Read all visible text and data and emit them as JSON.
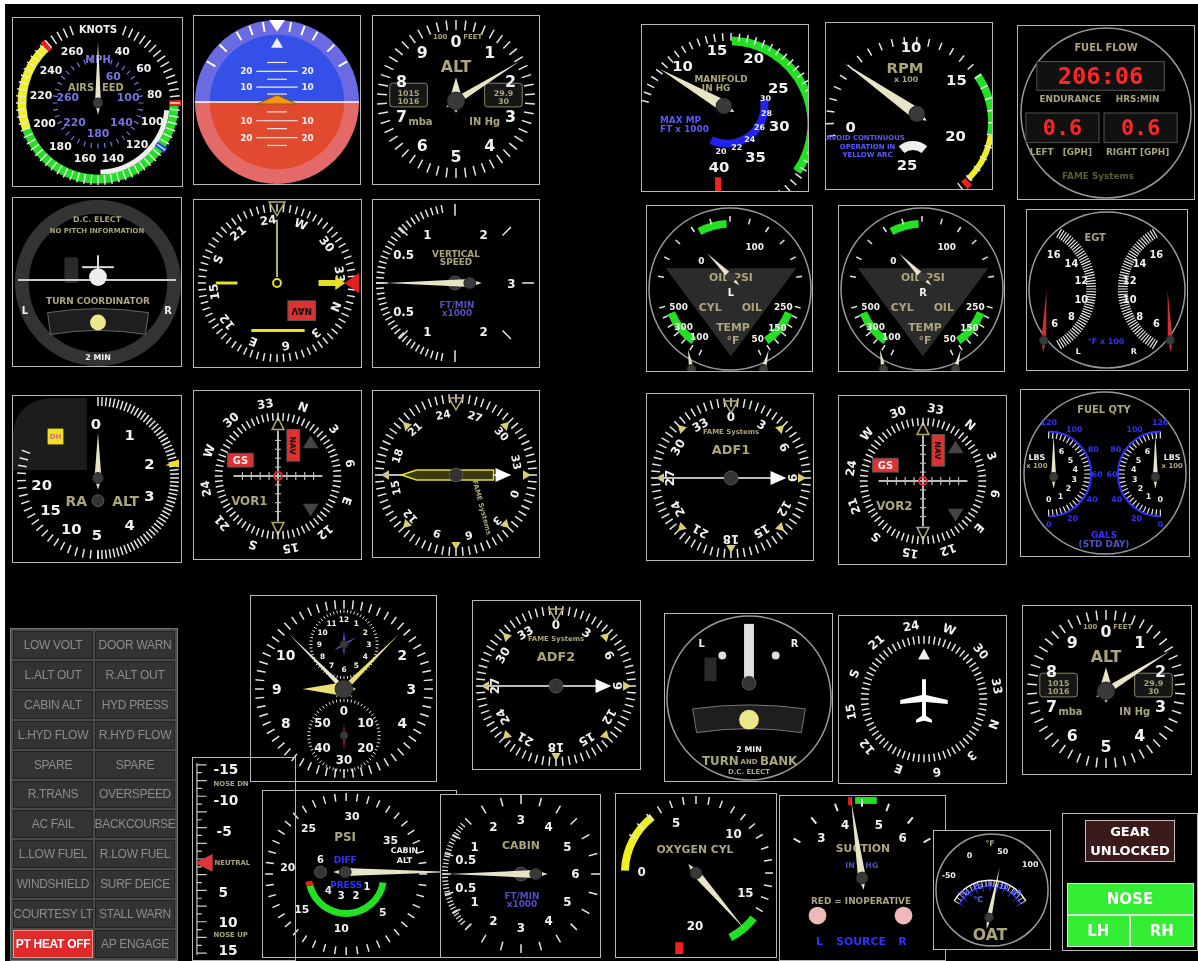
{
  "instruments": [
    {
      "kind": "dial",
      "scales": [
        [
          "40",
          "60",
          "80",
          "100",
          "120",
          "140",
          "160",
          "180",
          "200",
          "220",
          "240",
          "260"
        ],
        [
          "60",
          "100",
          "140",
          "180",
          "220",
          "260"
        ]
      ],
      "labels": [
        "KNOTS",
        "MPH",
        "AIRS",
        "EED"
      ]
    },
    {
      "kind": "dial",
      "labels": [
        "20",
        "20",
        "10",
        "10",
        "10",
        "10",
        "20",
        "20"
      ]
    },
    {
      "kind": "dial",
      "scales": [
        [
          "0",
          "1",
          "2",
          "3",
          "4",
          "5",
          "6",
          "7",
          "8",
          "9"
        ]
      ],
      "labels": [
        "100",
        "FEET",
        "ALT",
        "1015",
        "1016",
        "29.9",
        "30",
        "mba",
        "IN Hg"
      ]
    },
    {
      "kind": "dial",
      "scales": [
        [
          "10",
          "15",
          "20",
          "25",
          "30",
          "35",
          "40"
        ],
        [
          "20",
          "22",
          "24",
          "26",
          "28",
          "30"
        ]
      ],
      "labels": [
        "MANIFOLD",
        "IN HG",
        "MAX MP",
        "FT x 1000"
      ]
    },
    {
      "kind": "dial",
      "scales": [
        [
          "0",
          "10",
          "15",
          "20",
          "25"
        ]
      ],
      "labels": [
        "RPM",
        "x 100",
        "AVOID CONTINUOUS",
        "OPERATION IN",
        "YELLOW ARC"
      ]
    },
    {
      "kind": "dial",
      "labels": [
        "FUEL FLOW",
        "ENDURANCE",
        "HRS:MIN",
        "LEFT",
        "[GPH]",
        "RIGHT [GPH]",
        "FAME Systems"
      ],
      "displays": [
        "206:06",
        "0.6",
        "0.6"
      ]
    },
    {
      "kind": "dial",
      "labels": [
        "D.C. ELECT",
        "NO PITCH INFORMATION",
        "TURN COORDINATOR",
        "L",
        "R",
        "2 MIN"
      ]
    },
    {
      "kind": "dial",
      "scales": [
        [
          "24",
          "W",
          "30",
          "33",
          "N",
          "3",
          "6",
          "E",
          "12",
          "15",
          "S",
          "21"
        ]
      ],
      "labels": [
        "NAV"
      ]
    },
    {
      "kind": "dial",
      "scales": [
        [
          "1",
          "2",
          "0.5",
          "3",
          "0.5",
          "1",
          "2"
        ]
      ],
      "labels": [
        "VERTICAL",
        "SPEED",
        "FT/MIN",
        "x1000"
      ]
    },
    {
      "kind": "dial",
      "labels": [
        "100",
        "0",
        "OIL PSI",
        "L",
        "500",
        "CYL",
        "OIL",
        "250",
        "300",
        "TEMP",
        "150",
        "100",
        "°F",
        "50"
      ]
    },
    {
      "kind": "dial",
      "labels": [
        "100",
        "0",
        "OIL PSI",
        "R",
        "500",
        "CYL",
        "OIL",
        "250",
        "300",
        "TEMP",
        "150",
        "100",
        "°F",
        "50"
      ]
    },
    {
      "kind": "dial",
      "scales": [
        [
          "16",
          "14",
          "12",
          "10",
          "8",
          "6"
        ],
        [
          "16",
          "14",
          "12",
          "10",
          "8",
          "6"
        ]
      ],
      "labels": [
        "EGT",
        "°F x 100",
        "L",
        "R"
      ]
    },
    {
      "kind": "dial",
      "scales": [
        [
          "0",
          "1",
          "2",
          "3",
          "4",
          "5",
          "10",
          "15",
          "20"
        ]
      ],
      "labels": [
        "DH",
        "RA",
        "ALT"
      ]
    },
    {
      "kind": "dial",
      "scales": [
        [
          "33",
          "N",
          "3",
          "6",
          "E",
          "12",
          "15",
          "S",
          "21",
          "24",
          "W",
          "30"
        ]
      ],
      "labels": [
        "GS",
        "NAV",
        "VOR1"
      ]
    },
    {
      "kind": "dial",
      "scales": [
        [
          "24",
          "27",
          "30",
          "33",
          "0",
          "3",
          "6",
          "9",
          "12",
          "15",
          "18",
          "21"
        ]
      ],
      "labels": [
        "FAME Systems"
      ]
    },
    {
      "kind": "dial",
      "scales": [
        [
          "0",
          "3",
          "6",
          "9",
          "12",
          "15",
          "18",
          "21",
          "24",
          "27",
          "30",
          "33"
        ]
      ],
      "labels": [
        "FAME Systems",
        "ADF1"
      ]
    },
    {
      "kind": "dial",
      "scales": [
        [
          "30",
          "33",
          "N",
          "3",
          "6",
          "E",
          "12",
          "15",
          "S",
          "21",
          "24",
          "W"
        ]
      ],
      "labels": [
        "GS",
        "NAV",
        "VOR2"
      ]
    },
    {
      "kind": "dial",
      "scales": [
        [
          "120",
          "100",
          "80",
          "60",
          "40",
          "20",
          "0"
        ],
        [
          "6",
          "5",
          "4",
          "3",
          "2",
          "1",
          "0"
        ],
        [
          "120",
          "100",
          "80",
          "60",
          "40",
          "20",
          "0"
        ],
        [
          "6",
          "5",
          "4",
          "3",
          "2",
          "1",
          "0"
        ]
      ],
      "labels": [
        "FUEL QTY",
        "LBS",
        "x 100",
        "LBS",
        "x 100",
        "GALS",
        "(STD DAY)"
      ]
    },
    {
      "kind": "annunciator",
      "lights": [
        {
          "label": "LOW VOLT",
          "on": false
        },
        {
          "label": "DOOR WARN",
          "on": false
        },
        {
          "label": "L.ALT OUT",
          "on": false
        },
        {
          "label": "R.ALT OUT",
          "on": false
        },
        {
          "label": "CABIN ALT",
          "on": false
        },
        {
          "label": "HYD PRESS",
          "on": false
        },
        {
          "label": "L.HYD FLOW",
          "on": false
        },
        {
          "label": "R.HYD FLOW",
          "on": false
        },
        {
          "label": "SPARE",
          "on": false
        },
        {
          "label": "SPARE",
          "on": false
        },
        {
          "label": "R.TRANS",
          "on": false
        },
        {
          "label": "OVERSPEED",
          "on": false
        },
        {
          "label": "AC FAIL",
          "on": false
        },
        {
          "label": "BACKCOURSE",
          "on": false
        },
        {
          "label": "L.LOW FUEL",
          "on": false
        },
        {
          "label": "R.LOW FUEL",
          "on": false
        },
        {
          "label": "WINDSHIELD",
          "on": false
        },
        {
          "label": "SURF DEICE",
          "on": false
        },
        {
          "label": "COURTESY LT",
          "on": false
        },
        {
          "label": "STALL WARN",
          "on": false
        },
        {
          "label": "PT HEAT OFF",
          "on": true
        },
        {
          "label": "AP ENGAGE",
          "on": false
        }
      ]
    },
    {
      "kind": "dial",
      "scales": [
        [
          "2",
          "3",
          "4",
          "8",
          "9",
          "10"
        ],
        [
          "11",
          "12",
          "1",
          "10",
          "2",
          "9",
          "3",
          "8",
          "4",
          "7",
          "5",
          "6"
        ],
        [
          "0",
          "10",
          "20",
          "30",
          "40",
          "50"
        ]
      ]
    },
    {
      "kind": "dial",
      "scales": [
        [
          "0",
          "3",
          "6",
          "9",
          "12",
          "15",
          "18",
          "21",
          "24",
          "27",
          "30",
          "33"
        ]
      ],
      "labels": [
        "FAME Systems",
        "ADF2"
      ]
    },
    {
      "kind": "dial",
      "labels": [
        "L",
        "R",
        "2 MIN",
        "TURN",
        "AND",
        "BANK",
        "D.C. ELECT"
      ]
    },
    {
      "kind": "dial",
      "scales": [
        [
          "24",
          "W",
          "30",
          "33",
          "N",
          "3",
          "6",
          "E",
          "12",
          "15",
          "S",
          "21"
        ]
      ]
    },
    {
      "kind": "dial",
      "scales": [
        [
          "0",
          "1",
          "2",
          "3",
          "4",
          "5",
          "6",
          "7",
          "8",
          "9"
        ]
      ],
      "labels": [
        "100",
        "FEET",
        "ALT",
        "1015",
        "1016",
        "29.9",
        "30",
        "mba",
        "IN Hg"
      ]
    },
    {
      "kind": "dial",
      "labels": [
        "-15",
        "NOSE DN",
        "-10",
        "-5",
        "NEUTRAL",
        "5",
        "10",
        "NOSE UP",
        "15"
      ]
    },
    {
      "kind": "dial",
      "scales": [
        [
          "25",
          "30",
          "35",
          "20",
          "15",
          "10",
          "5"
        ],
        [
          "6",
          "4",
          "3",
          "2",
          "1"
        ]
      ],
      "labels": [
        "PSI",
        "CABIN",
        "DIFF",
        "ALT",
        "PRESS"
      ]
    },
    {
      "kind": "dial",
      "scales": [
        [
          "3",
          "2",
          "4",
          "1",
          "5",
          "0.5",
          "6",
          "0.5",
          "1",
          "5",
          "2",
          "4",
          "3"
        ]
      ],
      "labels": [
        "CABIN",
        "FT/MIN",
        "x1000"
      ]
    },
    {
      "kind": "dial",
      "scales": [
        [
          "5",
          "10",
          "0",
          "15",
          "20"
        ]
      ],
      "labels": [
        "OXYGEN CYL"
      ]
    },
    {
      "kind": "dial",
      "scales": [
        [
          "3",
          "4",
          "5",
          "6"
        ]
      ],
      "labels": [
        "SUCTION",
        "IN",
        "HG",
        "RED = INOPERATIVE",
        "L",
        "SOURCE",
        "R"
      ]
    },
    {
      "kind": "dial",
      "scales": [
        [
          "-50",
          "0",
          "50",
          "100"
        ],
        [
          "-40",
          "-20",
          "0",
          "20",
          "40"
        ]
      ],
      "labels": [
        "°F",
        "°C",
        "OAT"
      ]
    },
    {
      "kind": "gear",
      "warning": {
        "label": "GEAR UNLOCKED",
        "on": true
      },
      "lights": [
        {
          "label": "NOSE",
          "on": true
        },
        {
          "label": "LH",
          "on": true
        },
        {
          "label": "RH",
          "on": true
        }
      ]
    }
  ]
}
